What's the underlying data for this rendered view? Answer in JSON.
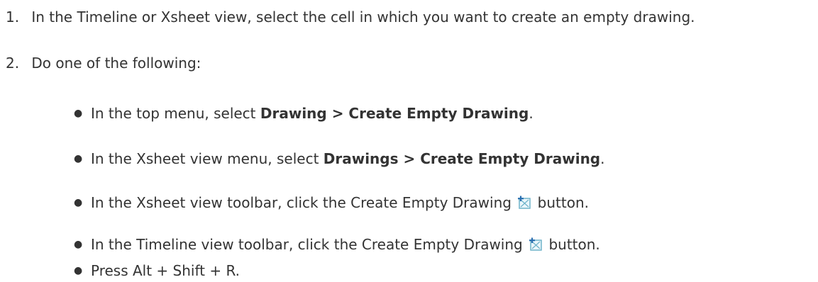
{
  "steps": [
    {
      "number": "1.",
      "text": "In the Timeline or Xsheet view, select the cell in which you want to create an empty drawing."
    },
    {
      "number": "2.",
      "text": "Do one of the following:"
    }
  ],
  "options": [
    {
      "prefix": "In the top menu, select ",
      "bold": "Drawing > Create Empty Drawing",
      "suffix": "."
    },
    {
      "prefix": "In the Xsheet view menu, select ",
      "bold": "Drawings > Create Empty Drawing",
      "suffix": "."
    },
    {
      "prefix": "In the Xsheet view toolbar, click the Create Empty Drawing ",
      "icon": "create-empty-drawing-icon",
      "suffix": " button."
    },
    {
      "prefix": "In the Timeline view toolbar, click the Create Empty Drawing ",
      "icon": "create-empty-drawing-icon",
      "suffix": " button."
    },
    {
      "text": "Press Alt + Shift + R."
    }
  ],
  "colors": {
    "text": "#333333",
    "icon_frame": "#6fb3c9",
    "icon_plus": "#2a6fb0"
  }
}
